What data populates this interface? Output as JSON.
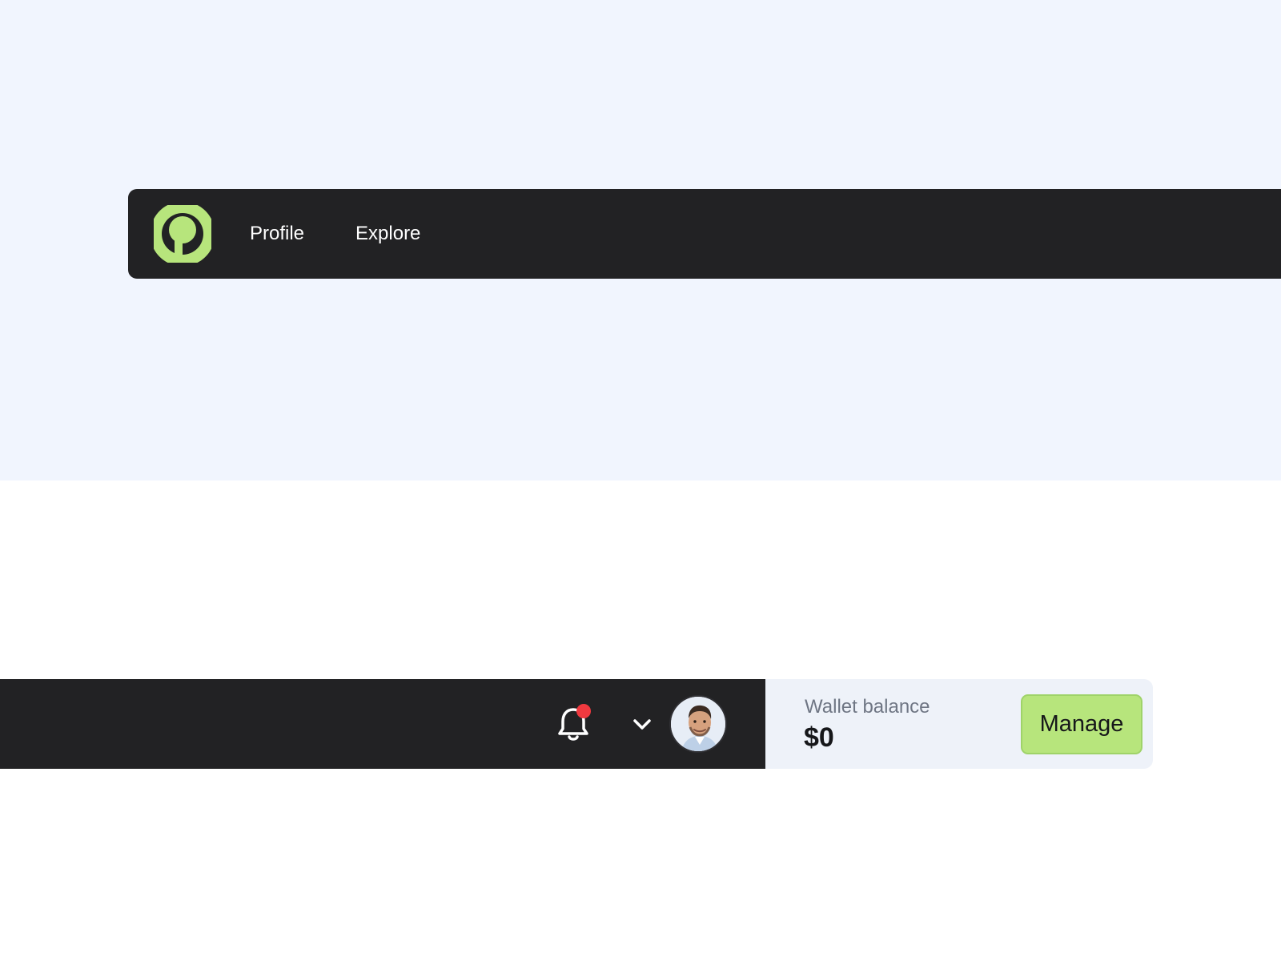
{
  "colors": {
    "top_background": "#f1f5fe",
    "bottom_background": "#ffffff",
    "navbar_background": "#222224",
    "brand_green": "#b7e57c",
    "notification_dot": "#f0393f",
    "wallet_background": "#eef2f9"
  },
  "navbar": {
    "logo_icon": "circle-logo-icon",
    "links": [
      {
        "label": "Profile"
      },
      {
        "label": "Explore"
      }
    ],
    "notification_icon": "bell-icon",
    "dropdown_icon": "chevron-down-icon",
    "avatar_icon": "user-avatar"
  },
  "wallet": {
    "label": "Wallet balance",
    "amount": "$0",
    "manage_label": "Manage"
  }
}
